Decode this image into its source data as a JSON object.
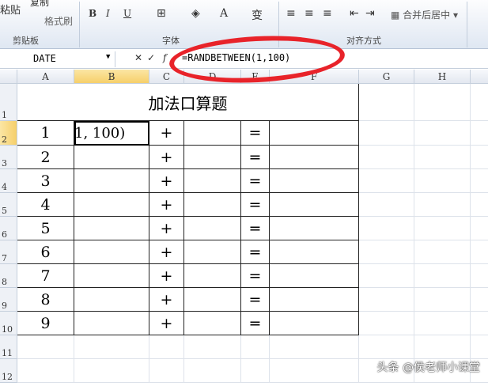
{
  "ribbon": {
    "paste": "粘贴",
    "copy": "复制",
    "format_painter": "格式刷",
    "clipboard_label": "剪贴板",
    "font_label": "字体",
    "align_label": "对齐方式",
    "bold": "B",
    "italic": "I",
    "underline": "U",
    "font_color": "A",
    "phonetic": "变",
    "merge_center": "合并后居中"
  },
  "formula_bar": {
    "name_box": "DATE",
    "cancel": "✕",
    "enter": "✓",
    "fx": "f",
    "formula": "=RANDBETWEEN(1,100)"
  },
  "columns": [
    "A",
    "B",
    "C",
    "D",
    "E",
    "F",
    "G",
    "H"
  ],
  "rows": [
    "1",
    "2",
    "3",
    "4",
    "5",
    "6",
    "7",
    "8",
    "9",
    "10",
    "11",
    "12"
  ],
  "sheet": {
    "title": "加法口算题",
    "editing_cell": "1, 100)",
    "numbers": [
      "1",
      "2",
      "3",
      "4",
      "5",
      "6",
      "7",
      "8",
      "9"
    ],
    "plus": "+",
    "equals": "="
  },
  "watermark": "头条 @侯老师小课堂",
  "colors": {
    "highlight": "#e8232a",
    "selected_header": "#f6cf6a"
  }
}
